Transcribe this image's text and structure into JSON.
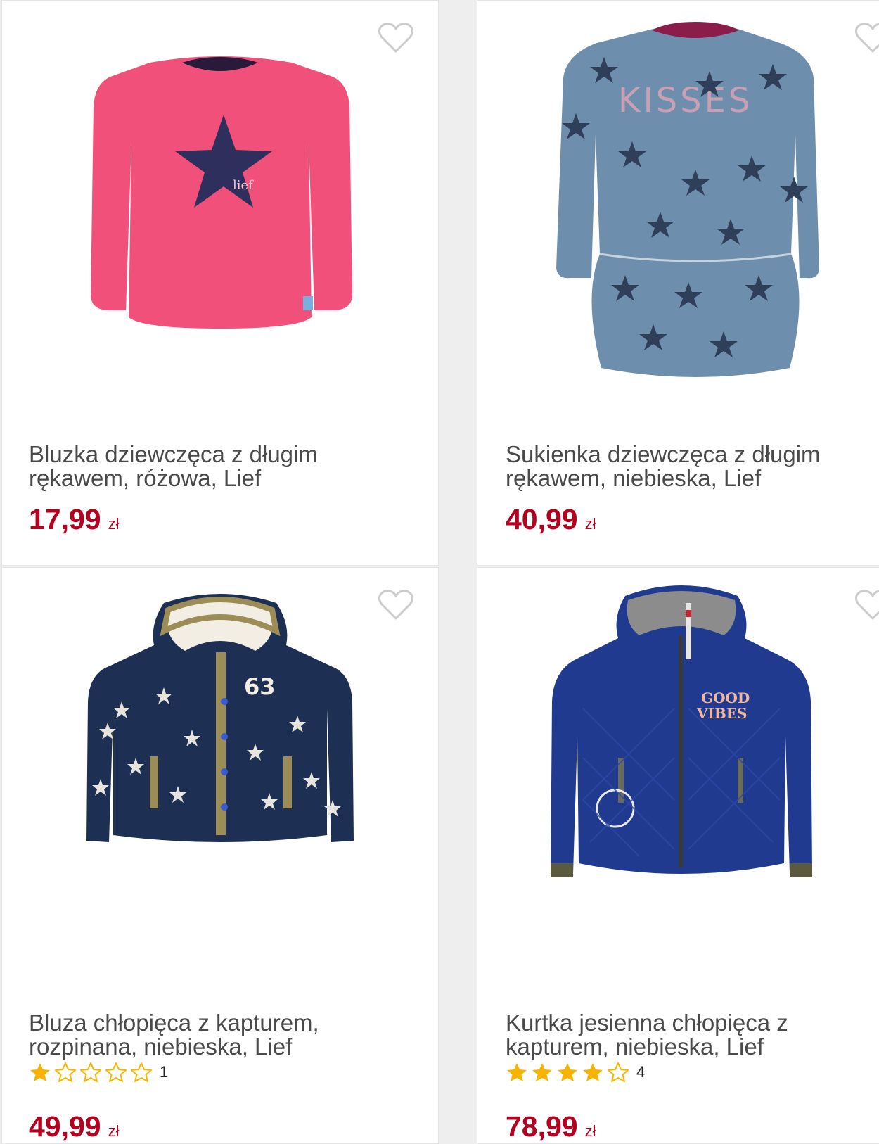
{
  "colors": {
    "price": "#b6001f",
    "title": "#4a4a4a",
    "star_filled": "#f6b400",
    "star_empty": "#f6b400",
    "heart_outline": "#cccccc"
  },
  "products": [
    {
      "title": "Bluzka dziewczęca z długim rękawem, różowa, Lief",
      "price": "17,99",
      "currency": "zł",
      "image_icon": "pink-longsleeve-shirt-with-star",
      "favorite_icon": "heart-outline-icon"
    },
    {
      "title": "Sukienka dziewczęca z długim rękawem, niebieska, Lief",
      "price": "40,99",
      "currency": "zł",
      "image_icon": "blue-star-print-dress",
      "favorite_icon": "heart-outline-icon"
    },
    {
      "title": "Bluza chłopięca z kapturem, rozpinana, niebieska, Lief",
      "price": "49,99",
      "currency": "zł",
      "rating": 1,
      "rating_count": "1",
      "image_icon": "navy-star-print-hoodie",
      "favorite_icon": "heart-outline-icon"
    },
    {
      "title": "Kurtka jesienna chłopięca z kapturem, niebieska, Lief",
      "price": "78,99",
      "currency": "zł",
      "rating": 4,
      "rating_count": "4",
      "image_icon": "blue-quilted-hooded-jacket",
      "favorite_icon": "heart-outline-icon"
    }
  ]
}
